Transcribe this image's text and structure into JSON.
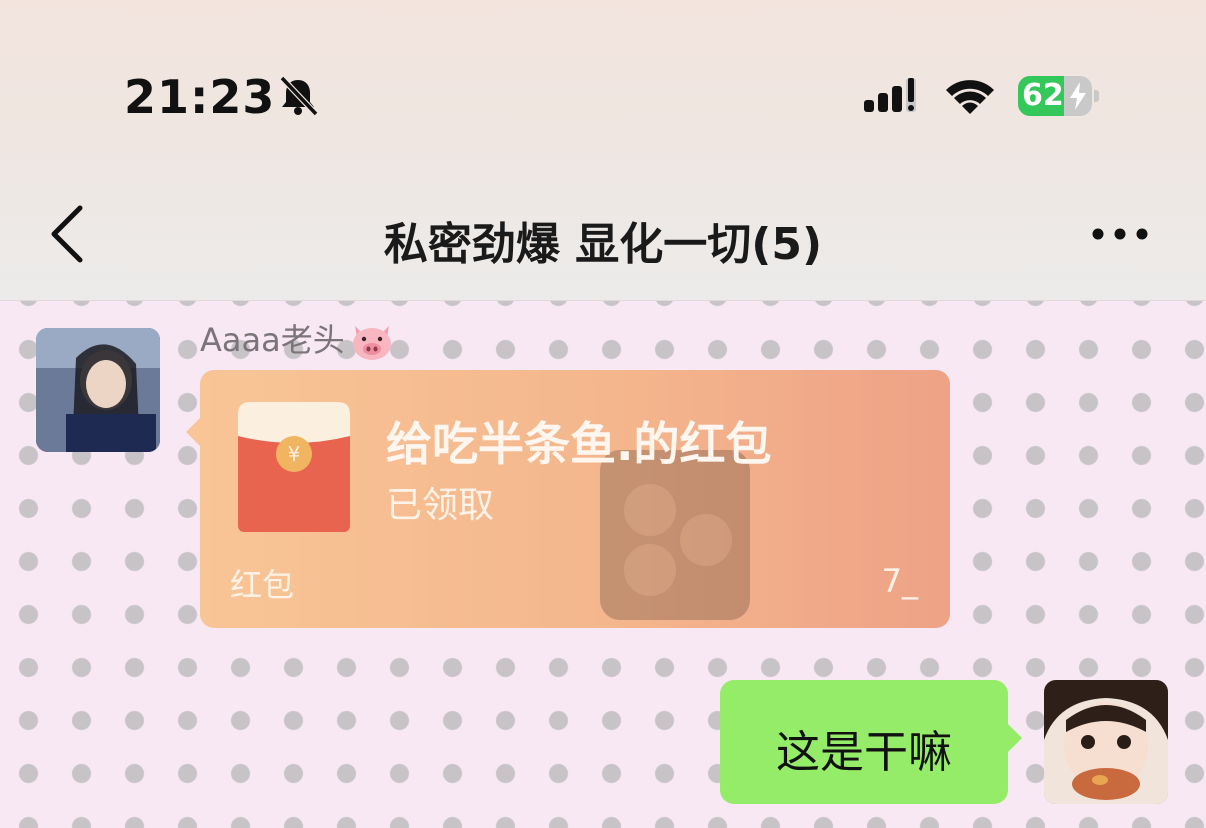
{
  "status_bar": {
    "time": "21:23",
    "battery_level": "62",
    "battery_percent": 62,
    "colors": {
      "battery": "#34c759"
    }
  },
  "nav": {
    "title": "私密劲爆 显化一切(5)",
    "back_icon": "chevron-left-icon",
    "more_icon": "more-dots-icon"
  },
  "messages": [
    {
      "sender": "Aaaa老头",
      "sender_emoji": "pig-face-icon",
      "type": "red_packet",
      "red_packet": {
        "title": "给吃半条鱼.的红包",
        "status": "已领取",
        "label": "红包",
        "number": "7_"
      }
    },
    {
      "sender": "me",
      "type": "text",
      "text": "这是干嘛"
    }
  ],
  "colors": {
    "chat_background": "#f7e8f3",
    "my_bubble": "#95ec69",
    "red_packet": "#f4b68d"
  }
}
